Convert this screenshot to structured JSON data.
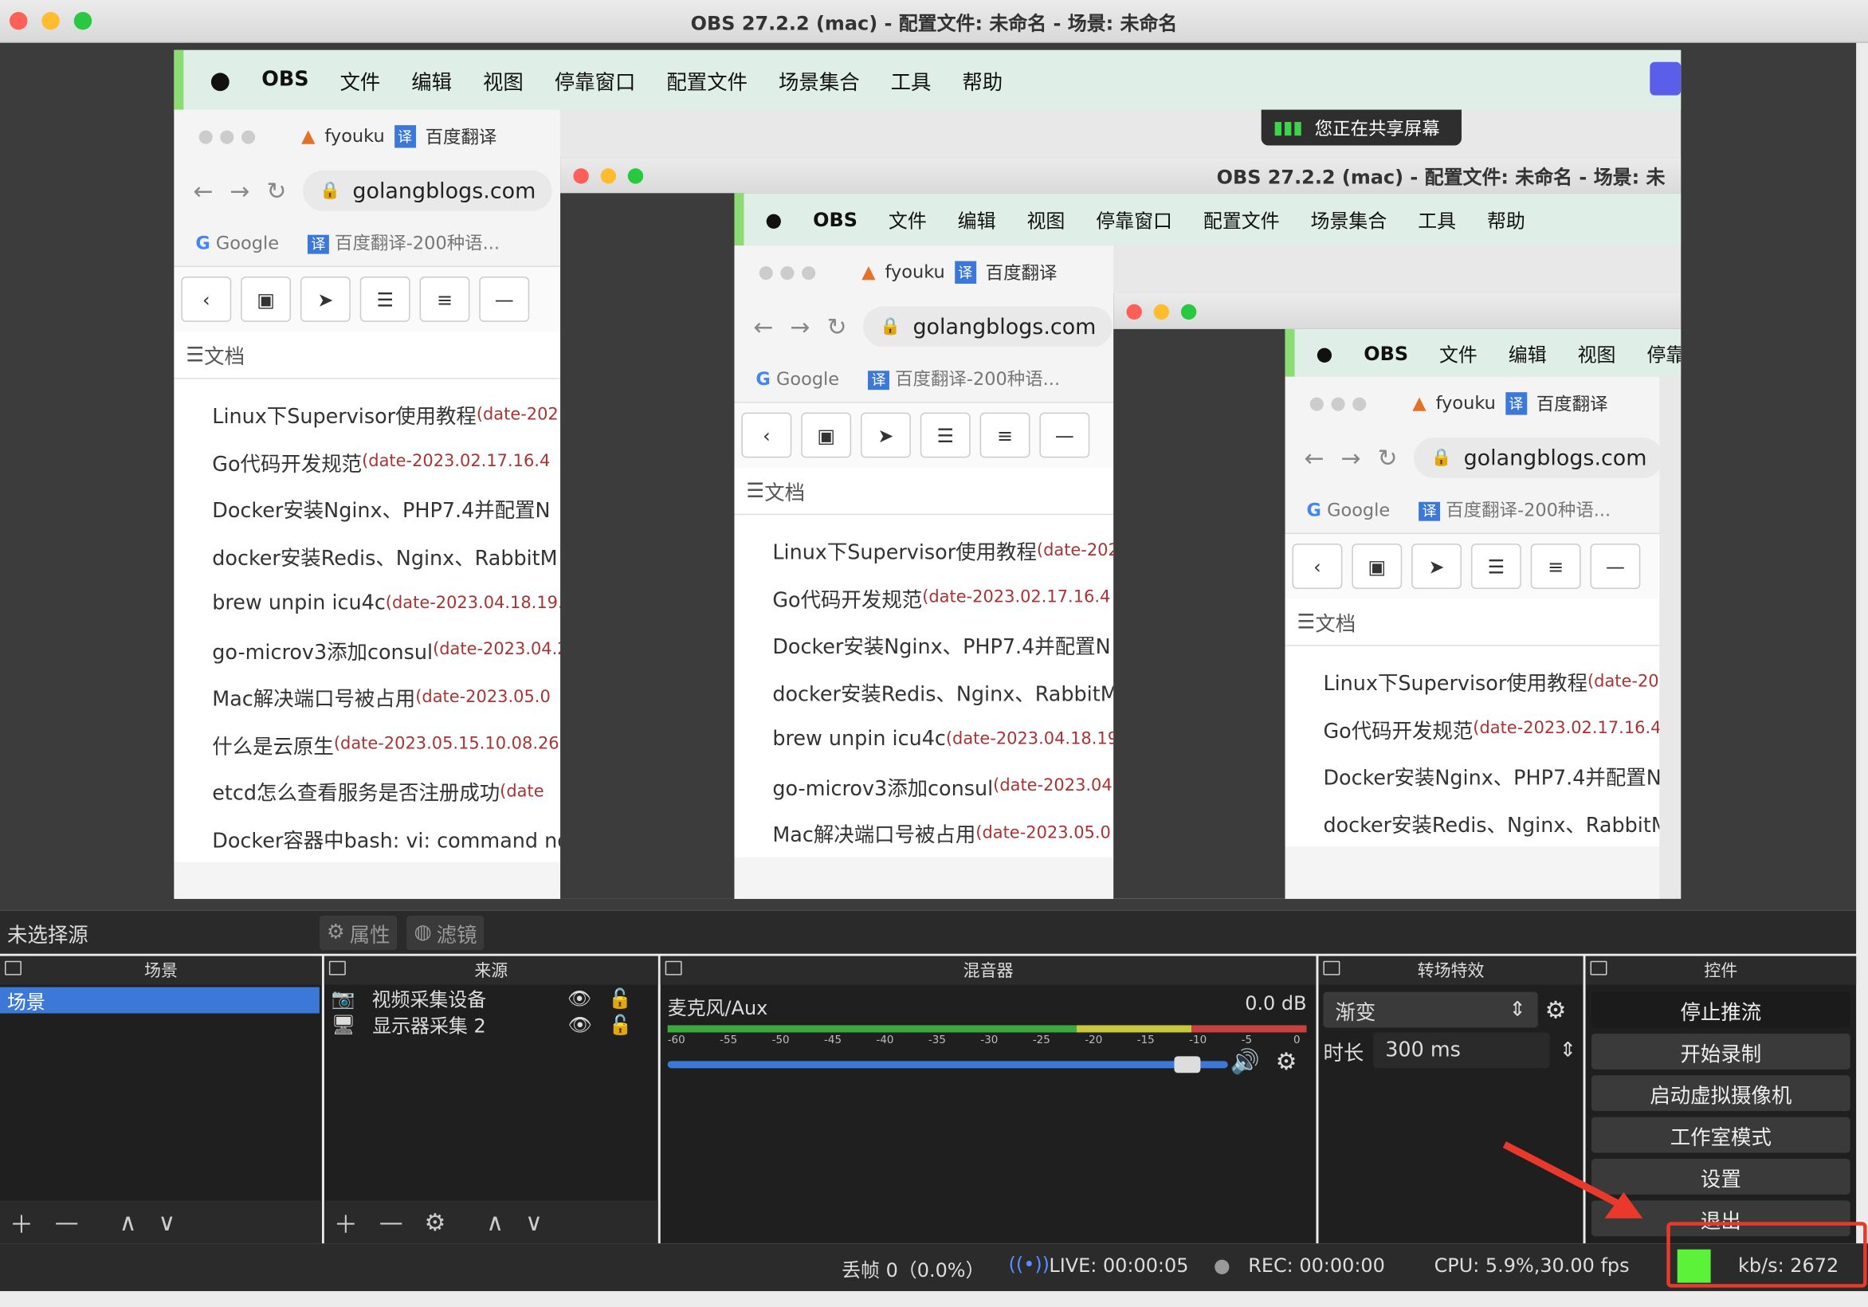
{
  "window": {
    "title": "OBS 27.2.2 (mac) - 配置文件: 未命名 - 场景: 未命名"
  },
  "inner_window": {
    "title": "OBS 27.2.2 (mac) - 配置文件: 未命名 - 场景: 未"
  },
  "menu": {
    "apple": "",
    "items": [
      "OBS",
      "文件",
      "编辑",
      "视图",
      "停靠窗口",
      "配置文件",
      "场景集合",
      "工具",
      "帮助"
    ]
  },
  "share_banner": "您正在共享屏幕",
  "browser": {
    "tab1": "fyouku",
    "tab2": "百度翻译",
    "url": "golangblogs.com",
    "bm1": "Google",
    "bm2": "百度翻译-200种语...",
    "doc_tab": "文档",
    "docs": [
      {
        "t": "Linux下Supervisor使用教程",
        "d": "(date-202"
      },
      {
        "t": "Go代码开发规范",
        "d": "(date-2023.02.17.16.4"
      },
      {
        "t": "Docker安装Nginx、PHP7.4并配置N",
        "d": ""
      },
      {
        "t": "docker安装Redis、Nginx、RabbitM",
        "d": ""
      },
      {
        "t": "brew unpin icu4c",
        "d": "(date-2023.04.18.19.1"
      },
      {
        "t": "go-microv3添加consul",
        "d": "(date-2023.04.2"
      },
      {
        "t": "Mac解决端口号被占用",
        "d": "(date-2023.05.0"
      },
      {
        "t": "什么是云原生",
        "d": "(date-2023.05.15.10.08.26"
      },
      {
        "t": "etcd怎么查看服务是否注册成功",
        "d": "(date"
      },
      {
        "t": "Docker容器中bash: vi: command no",
        "d": ""
      }
    ]
  },
  "toolbar": {
    "no_source": "未选择源",
    "properties": "属性",
    "filters": "滤镜"
  },
  "scenes": {
    "title": "场景",
    "items": [
      "场景"
    ]
  },
  "sources": {
    "title": "来源",
    "items": [
      "视频采集设备",
      "显示器采集 2"
    ]
  },
  "mixer": {
    "title": "混音器",
    "track": "麦克风/Aux",
    "db": "0.0 dB",
    "ticks": [
      "-60",
      "-55",
      "-50",
      "-45",
      "-40",
      "-35",
      "-30",
      "-25",
      "-20",
      "-15",
      "-10",
      "-5",
      "0"
    ],
    "volume": 0.95
  },
  "transition": {
    "title": "转场特效",
    "type": "渐变",
    "duration_label": "时长",
    "duration": "300 ms"
  },
  "controls": {
    "title": "控件",
    "buttons": [
      "停止推流",
      "开始录制",
      "启动虚拟摄像机",
      "工作室模式",
      "设置",
      "退出"
    ]
  },
  "status": {
    "dropped": "丢帧 0（0.0%）",
    "live": "LIVE: 00:00:05",
    "rec": "REC: 00:00:00",
    "cpu": "CPU: 5.9%,30.00 fps",
    "kbps": "kb/s: 2672"
  },
  "colors": {
    "accent": "#3b78d8",
    "highlight": "#e8392a",
    "stream_ok": "#5cf23a"
  }
}
